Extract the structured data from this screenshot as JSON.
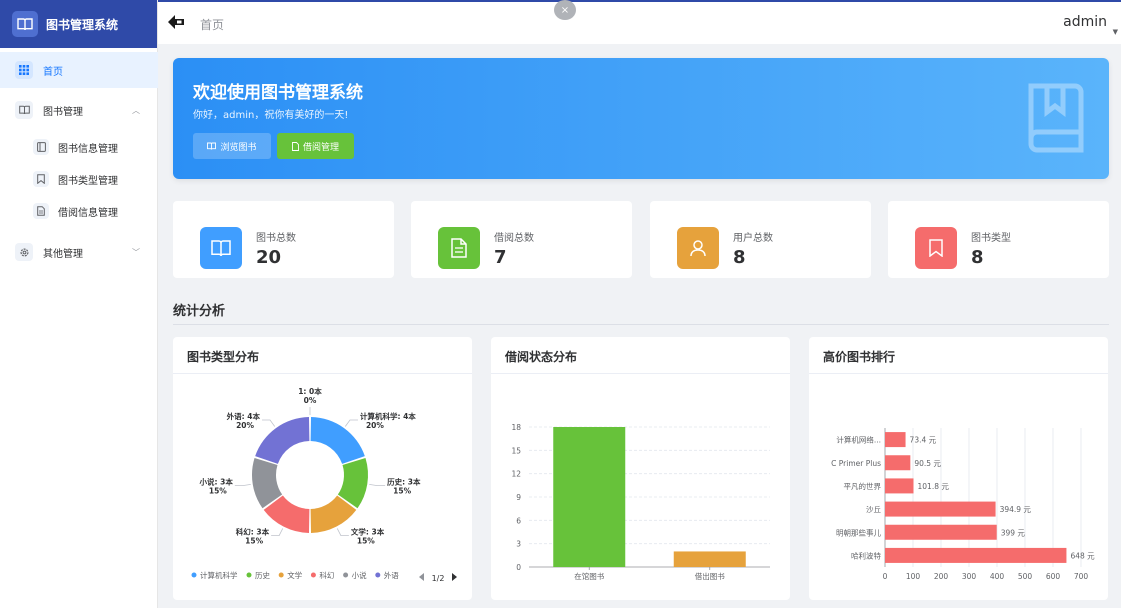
{
  "sidebar": {
    "title": "图书管理系统",
    "items": [
      {
        "label": "首页"
      },
      {
        "label": "图书管理"
      },
      {
        "label": "图书信息管理"
      },
      {
        "label": "图书类型管理"
      },
      {
        "label": "借阅信息管理"
      },
      {
        "label": "其他管理"
      }
    ]
  },
  "header": {
    "breadcrumb": "首页",
    "user": "admin",
    "close": "×"
  },
  "banner": {
    "title": "欢迎使用图书管理系统",
    "subtitle": "你好，admin，祝你有美好的一天!",
    "browse_label": "浏览图书",
    "borrow_label": "借阅管理"
  },
  "stats": [
    {
      "label": "图书总数",
      "value": "20",
      "color": "#409eff"
    },
    {
      "label": "借阅总数",
      "value": "7",
      "color": "#67c23a"
    },
    {
      "label": "用户总数",
      "value": "8",
      "color": "#e6a23c"
    },
    {
      "label": "图书类型",
      "value": "8",
      "color": "#f56c6c"
    }
  ],
  "section_title": "统计分析",
  "panels": {
    "pie_title": "图书类型分布",
    "bar_title": "借阅状态分布",
    "hbar_title": "高价图书排行"
  },
  "chart_data": [
    {
      "type": "pie",
      "title": "图书类型分布",
      "slices": [
        {
          "name": "计算机科学",
          "value": 4,
          "label": "计算机科学: 4本",
          "pct": "20%",
          "color": "#409eff"
        },
        {
          "name": "历史",
          "value": 3,
          "label": "历史: 3本",
          "pct": "15%",
          "color": "#67c23a"
        },
        {
          "name": "文学",
          "value": 3,
          "label": "文学: 3本",
          "pct": "15%",
          "color": "#e6a23c"
        },
        {
          "name": "科幻",
          "value": 3,
          "label": "科幻: 3本",
          "pct": "15%",
          "color": "#f56c6c"
        },
        {
          "name": "小说",
          "value": 3,
          "label": "小说: 3本",
          "pct": "15%",
          "color": "#909399"
        },
        {
          "name": "外语",
          "value": 4,
          "label": "外语: 4本",
          "pct": "20%",
          "color": "#7272d4"
        },
        {
          "name": "1",
          "value": 0,
          "label": "1: 0本",
          "pct": "0%",
          "color": "#c0c4cc"
        }
      ],
      "legend": [
        "计算机科学",
        "历史",
        "文学",
        "科幻",
        "小说",
        "外语"
      ],
      "legend_page": "1/2"
    },
    {
      "type": "bar",
      "title": "借阅状态分布",
      "categories": [
        "在馆图书",
        "借出图书"
      ],
      "values": [
        18,
        2
      ],
      "colors": [
        "#67c23a",
        "#e6a23c"
      ],
      "ylim": [
        0,
        18
      ],
      "yticks": [
        0,
        3,
        6,
        9,
        12,
        15,
        18
      ]
    },
    {
      "type": "bar",
      "orientation": "horizontal",
      "title": "高价图书排行",
      "categories": [
        "计算机网络...",
        "C Primer Plus",
        "平凡的世界",
        "沙丘",
        "明朝那些事儿",
        "哈利波特"
      ],
      "values": [
        73.4,
        90.5,
        101.8,
        394.9,
        399,
        648
      ],
      "value_labels": [
        "73.4 元",
        "90.5 元",
        "101.8 元",
        "394.9 元",
        "399 元",
        "648 元"
      ],
      "color": "#f56c6c",
      "xlim": [
        0,
        700
      ],
      "xticks": [
        0,
        100,
        200,
        300,
        400,
        500,
        600,
        700
      ]
    }
  ]
}
